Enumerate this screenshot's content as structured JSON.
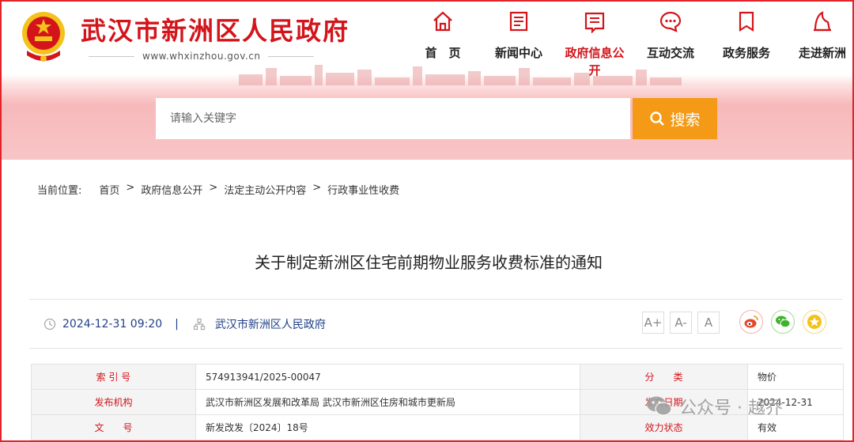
{
  "site": {
    "title": "武汉市新洲区人民政府",
    "url": "www.whxinzhou.gov.cn"
  },
  "nav": [
    {
      "label": "首　页",
      "icon": "home-icon",
      "active": false
    },
    {
      "label": "新闻中心",
      "icon": "news-icon",
      "active": false
    },
    {
      "label": "政府信息公开",
      "icon": "open-info-icon",
      "active": true
    },
    {
      "label": "互动交流",
      "icon": "chat-icon",
      "active": false
    },
    {
      "label": "政务服务",
      "icon": "service-icon",
      "active": false
    },
    {
      "label": "走进新洲",
      "icon": "landmark-icon",
      "active": false
    }
  ],
  "search": {
    "placeholder": "请输入关键字",
    "button_label": "搜索"
  },
  "breadcrumb": {
    "prefix": "当前位置:",
    "items": [
      "首页",
      "政府信息公开",
      "法定主动公开内容",
      "行政事业性收费"
    ],
    "separator": ">"
  },
  "article": {
    "title": "关于制定新洲区住宅前期物业服务收费标准的通知",
    "date": "2024-12-31 09:20",
    "meta_sep": "|",
    "publisher": "武汉市新洲区人民政府",
    "font_sizes": [
      "A+",
      "A-",
      "A"
    ]
  },
  "share": [
    "weibo-icon",
    "wechat-icon",
    "favorite-icon"
  ],
  "info_table": [
    {
      "k1": "索 引 号",
      "v1": "574913941/2025-00047",
      "k2": "分　　类",
      "v2": "物价"
    },
    {
      "k1": "发布机构",
      "v1": "武汉市新洲区发展和改革局 武汉市新洲区住房和城市更新局",
      "k2": "发文日期",
      "v2": "2024-12-31"
    },
    {
      "k1": "文　　号",
      "v1": "新发改发〔2024〕18号",
      "k2": "效力状态",
      "v2": "有效"
    }
  ],
  "watermark": "公众号 · 越乔",
  "colors": {
    "brand_red": "#d3151b",
    "search_orange": "#f49a17",
    "meta_blue": "#1f3f86"
  }
}
